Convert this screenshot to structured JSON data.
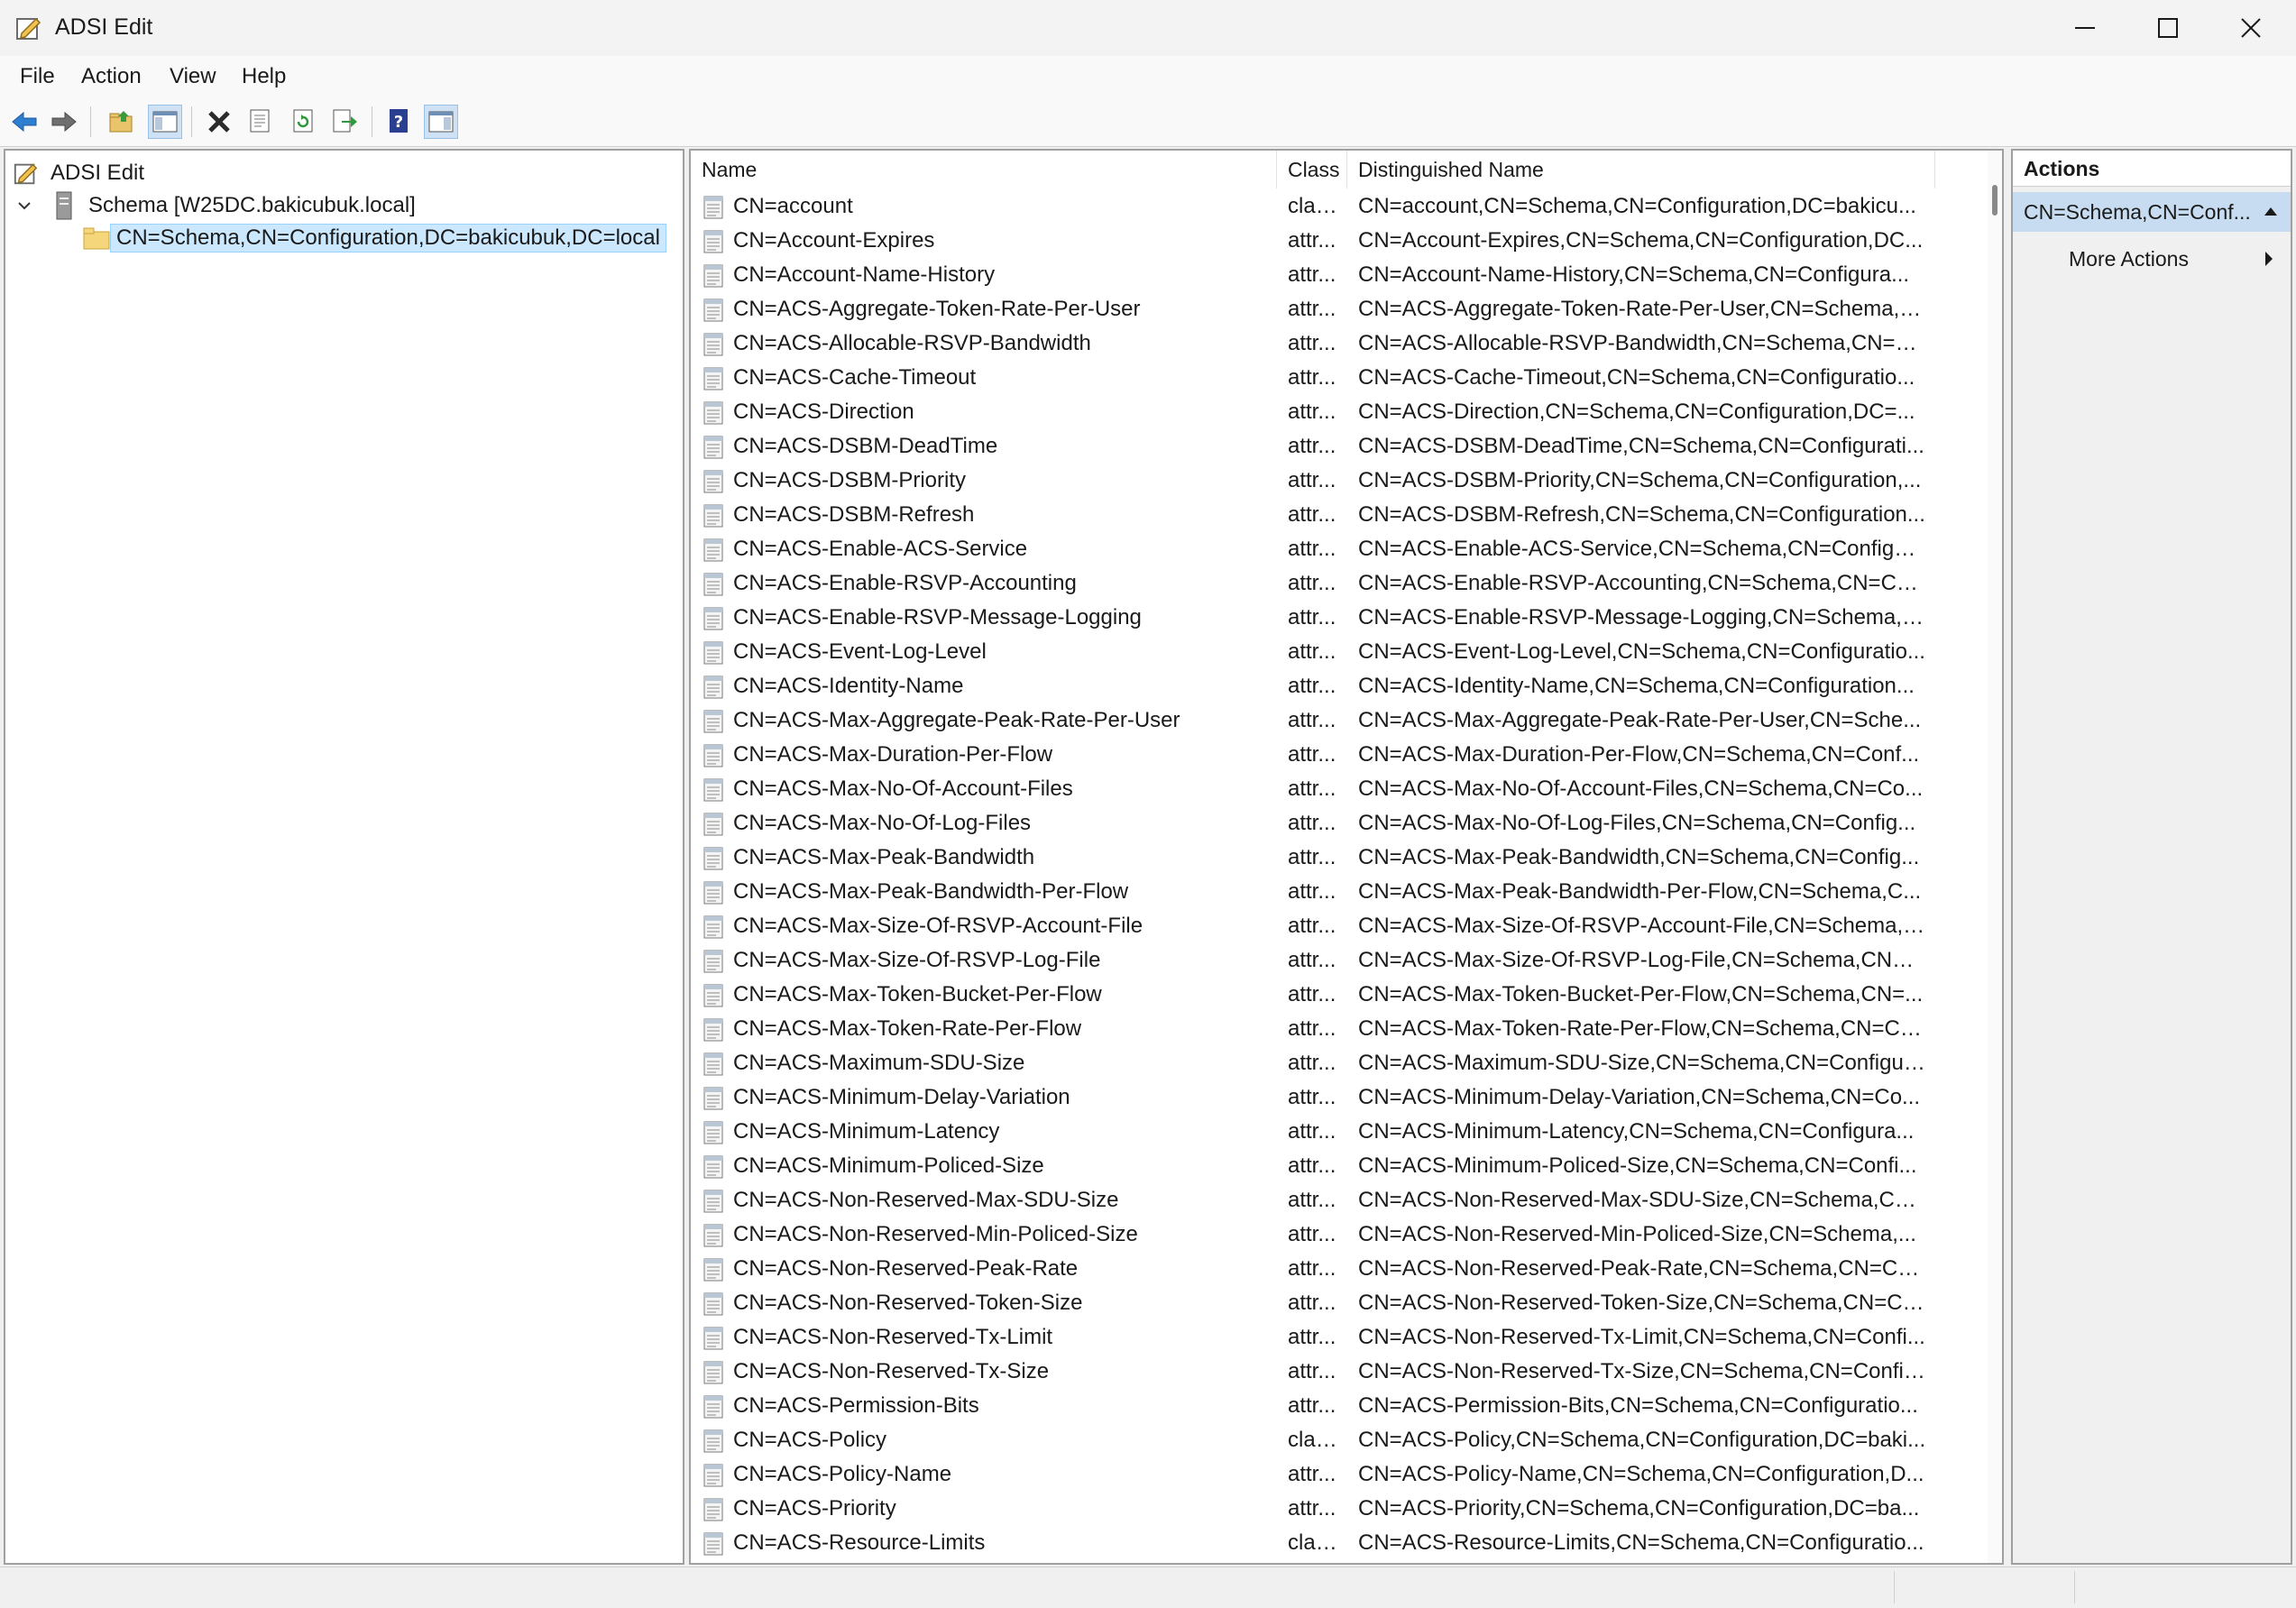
{
  "window": {
    "title": "ADSI Edit"
  },
  "menu": [
    "File",
    "Action",
    "View",
    "Help"
  ],
  "toolbar": [
    "back-icon",
    "forward-icon",
    "up-folder-icon",
    "show-hide-console-tree-icon",
    "delete-icon",
    "properties-icon",
    "refresh-icon",
    "export-list-icon",
    "help-icon",
    "show-hide-action-pane-icon"
  ],
  "tree": {
    "root": "ADSI Edit",
    "connection": "Schema [W25DC.bakicubuk.local]",
    "selected": "CN=Schema,CN=Configuration,DC=bakicubuk,DC=local"
  },
  "list": {
    "columns": {
      "name": "Name",
      "class": "Class",
      "dn": "Distinguished Name"
    },
    "rows": [
      {
        "name": "CN=account",
        "class": "clas...",
        "dn": "CN=account,CN=Schema,CN=Configuration,DC=bakicu..."
      },
      {
        "name": "CN=Account-Expires",
        "class": "attr...",
        "dn": "CN=Account-Expires,CN=Schema,CN=Configuration,DC..."
      },
      {
        "name": "CN=Account-Name-History",
        "class": "attr...",
        "dn": "CN=Account-Name-History,CN=Schema,CN=Configura..."
      },
      {
        "name": "CN=ACS-Aggregate-Token-Rate-Per-User",
        "class": "attr...",
        "dn": "CN=ACS-Aggregate-Token-Rate-Per-User,CN=Schema,C..."
      },
      {
        "name": "CN=ACS-Allocable-RSVP-Bandwidth",
        "class": "attr...",
        "dn": "CN=ACS-Allocable-RSVP-Bandwidth,CN=Schema,CN=C..."
      },
      {
        "name": "CN=ACS-Cache-Timeout",
        "class": "attr...",
        "dn": "CN=ACS-Cache-Timeout,CN=Schema,CN=Configuratio..."
      },
      {
        "name": "CN=ACS-Direction",
        "class": "attr...",
        "dn": "CN=ACS-Direction,CN=Schema,CN=Configuration,DC=..."
      },
      {
        "name": "CN=ACS-DSBM-DeadTime",
        "class": "attr...",
        "dn": "CN=ACS-DSBM-DeadTime,CN=Schema,CN=Configurati..."
      },
      {
        "name": "CN=ACS-DSBM-Priority",
        "class": "attr...",
        "dn": "CN=ACS-DSBM-Priority,CN=Schema,CN=Configuration,..."
      },
      {
        "name": "CN=ACS-DSBM-Refresh",
        "class": "attr...",
        "dn": "CN=ACS-DSBM-Refresh,CN=Schema,CN=Configuration..."
      },
      {
        "name": "CN=ACS-Enable-ACS-Service",
        "class": "attr...",
        "dn": "CN=ACS-Enable-ACS-Service,CN=Schema,CN=Configur..."
      },
      {
        "name": "CN=ACS-Enable-RSVP-Accounting",
        "class": "attr...",
        "dn": "CN=ACS-Enable-RSVP-Accounting,CN=Schema,CN=Co..."
      },
      {
        "name": "CN=ACS-Enable-RSVP-Message-Logging",
        "class": "attr...",
        "dn": "CN=ACS-Enable-RSVP-Message-Logging,CN=Schema,C..."
      },
      {
        "name": "CN=ACS-Event-Log-Level",
        "class": "attr...",
        "dn": "CN=ACS-Event-Log-Level,CN=Schema,CN=Configuratio..."
      },
      {
        "name": "CN=ACS-Identity-Name",
        "class": "attr...",
        "dn": "CN=ACS-Identity-Name,CN=Schema,CN=Configuration..."
      },
      {
        "name": "CN=ACS-Max-Aggregate-Peak-Rate-Per-User",
        "class": "attr...",
        "dn": "CN=ACS-Max-Aggregate-Peak-Rate-Per-User,CN=Sche..."
      },
      {
        "name": "CN=ACS-Max-Duration-Per-Flow",
        "class": "attr...",
        "dn": "CN=ACS-Max-Duration-Per-Flow,CN=Schema,CN=Conf..."
      },
      {
        "name": "CN=ACS-Max-No-Of-Account-Files",
        "class": "attr...",
        "dn": "CN=ACS-Max-No-Of-Account-Files,CN=Schema,CN=Co..."
      },
      {
        "name": "CN=ACS-Max-No-Of-Log-Files",
        "class": "attr...",
        "dn": "CN=ACS-Max-No-Of-Log-Files,CN=Schema,CN=Config..."
      },
      {
        "name": "CN=ACS-Max-Peak-Bandwidth",
        "class": "attr...",
        "dn": "CN=ACS-Max-Peak-Bandwidth,CN=Schema,CN=Config..."
      },
      {
        "name": "CN=ACS-Max-Peak-Bandwidth-Per-Flow",
        "class": "attr...",
        "dn": "CN=ACS-Max-Peak-Bandwidth-Per-Flow,CN=Schema,C..."
      },
      {
        "name": "CN=ACS-Max-Size-Of-RSVP-Account-File",
        "class": "attr...",
        "dn": "CN=ACS-Max-Size-Of-RSVP-Account-File,CN=Schema,C..."
      },
      {
        "name": "CN=ACS-Max-Size-Of-RSVP-Log-File",
        "class": "attr...",
        "dn": "CN=ACS-Max-Size-Of-RSVP-Log-File,CN=Schema,CN=C..."
      },
      {
        "name": "CN=ACS-Max-Token-Bucket-Per-Flow",
        "class": "attr...",
        "dn": "CN=ACS-Max-Token-Bucket-Per-Flow,CN=Schema,CN=..."
      },
      {
        "name": "CN=ACS-Max-Token-Rate-Per-Flow",
        "class": "attr...",
        "dn": "CN=ACS-Max-Token-Rate-Per-Flow,CN=Schema,CN=Co..."
      },
      {
        "name": "CN=ACS-Maximum-SDU-Size",
        "class": "attr...",
        "dn": "CN=ACS-Maximum-SDU-Size,CN=Schema,CN=Configur..."
      },
      {
        "name": "CN=ACS-Minimum-Delay-Variation",
        "class": "attr...",
        "dn": "CN=ACS-Minimum-Delay-Variation,CN=Schema,CN=Co..."
      },
      {
        "name": "CN=ACS-Minimum-Latency",
        "class": "attr...",
        "dn": "CN=ACS-Minimum-Latency,CN=Schema,CN=Configura..."
      },
      {
        "name": "CN=ACS-Minimum-Policed-Size",
        "class": "attr...",
        "dn": "CN=ACS-Minimum-Policed-Size,CN=Schema,CN=Confi..."
      },
      {
        "name": "CN=ACS-Non-Reserved-Max-SDU-Size",
        "class": "attr...",
        "dn": "CN=ACS-Non-Reserved-Max-SDU-Size,CN=Schema,CN..."
      },
      {
        "name": "CN=ACS-Non-Reserved-Min-Policed-Size",
        "class": "attr...",
        "dn": "CN=ACS-Non-Reserved-Min-Policed-Size,CN=Schema,..."
      },
      {
        "name": "CN=ACS-Non-Reserved-Peak-Rate",
        "class": "attr...",
        "dn": "CN=ACS-Non-Reserved-Peak-Rate,CN=Schema,CN=Co..."
      },
      {
        "name": "CN=ACS-Non-Reserved-Token-Size",
        "class": "attr...",
        "dn": "CN=ACS-Non-Reserved-Token-Size,CN=Schema,CN=Co..."
      },
      {
        "name": "CN=ACS-Non-Reserved-Tx-Limit",
        "class": "attr...",
        "dn": "CN=ACS-Non-Reserved-Tx-Limit,CN=Schema,CN=Confi..."
      },
      {
        "name": "CN=ACS-Non-Reserved-Tx-Size",
        "class": "attr...",
        "dn": "CN=ACS-Non-Reserved-Tx-Size,CN=Schema,CN=Config..."
      },
      {
        "name": "CN=ACS-Permission-Bits",
        "class": "attr...",
        "dn": "CN=ACS-Permission-Bits,CN=Schema,CN=Configuratio..."
      },
      {
        "name": "CN=ACS-Policy",
        "class": "clas...",
        "dn": "CN=ACS-Policy,CN=Schema,CN=Configuration,DC=baki..."
      },
      {
        "name": "CN=ACS-Policy-Name",
        "class": "attr...",
        "dn": "CN=ACS-Policy-Name,CN=Schema,CN=Configuration,D..."
      },
      {
        "name": "CN=ACS-Priority",
        "class": "attr...",
        "dn": "CN=ACS-Priority,CN=Schema,CN=Configuration,DC=ba..."
      },
      {
        "name": "CN=ACS-Resource-Limits",
        "class": "clas...",
        "dn": "CN=ACS-Resource-Limits,CN=Schema,CN=Configuratio..."
      }
    ]
  },
  "actions": {
    "header": "Actions",
    "section": "CN=Schema,CN=Conf...",
    "more": "More Actions"
  }
}
